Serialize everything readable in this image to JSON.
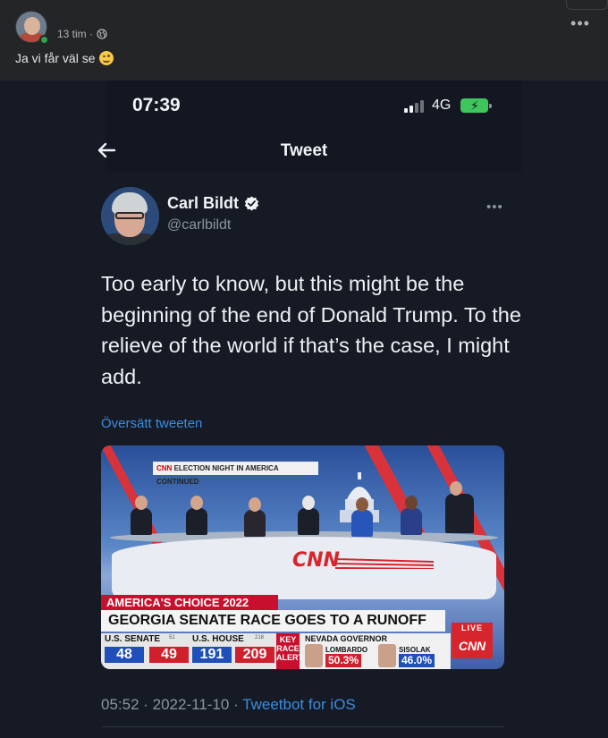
{
  "facebook_post": {
    "author_name": "…",
    "time": "13 tim ·",
    "more_label": "•••",
    "text": "Ja vi får väl se",
    "emoji": "winking-smile-emoji"
  },
  "phone_status": {
    "time": "07:39",
    "network": "4G",
    "battery_charging": true
  },
  "twitter_header": {
    "title": "Tweet"
  },
  "tweet": {
    "author_name": "Carl Bildt",
    "verified": true,
    "handle": "@carlbildt",
    "more_label": "•••",
    "text": "Too early to know, but this might be the beginning of the end of Donald Trump. To the relieve of the world if that’s the case, I might add.",
    "translate_link": "Översätt tweeten",
    "timestamp": "05:52 · 2022-11-10 · ",
    "client": "Tweetbot for iOS"
  },
  "media": {
    "banner_top_brand": "CNN",
    "banner_top": "ELECTION NIGHT IN AMERICA CONTINUED",
    "desk_logo": "CNN",
    "lower_third_top": "AMERICA'S CHOICE 2022",
    "lower_third_main": "GEORGIA SENATE RACE GOES TO A RUNOFF",
    "live": "LIVE",
    "cnn_bug": "CNN",
    "ticker": {
      "senate_label": "U.S. SENATE",
      "senate_needed": "51",
      "senate_dem": "48",
      "senate_rep": "49",
      "house_label": "U.S. HOUSE",
      "house_needed": "218",
      "house_dem": "191",
      "house_rep": "209",
      "key_race": "KEY RACE ALERT",
      "nevada_label": "NEVADA GOVERNOR",
      "cand1_name": "LOMBARDO",
      "cand1_pct": "50.3%",
      "cand2_name": "SISOLAK",
      "cand2_pct": "46.0%"
    }
  },
  "colors": {
    "facebook_bg": "#242526",
    "tweet_bg": "#151a25",
    "link_blue": "#3b8de0",
    "battery_green": "#3ec55b",
    "cnn_red": "#d6252c"
  }
}
